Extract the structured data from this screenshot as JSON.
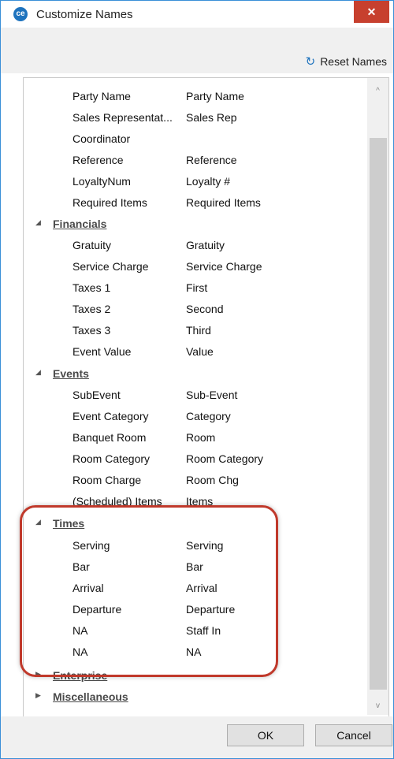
{
  "window": {
    "title": "Customize Names",
    "app_icon_label": "ce",
    "close_label": "✕"
  },
  "toolbar": {
    "reset_label": "Reset Names",
    "reset_icon": "↻"
  },
  "scrollbar": {
    "up_arrow": "^",
    "down_arrow": "v"
  },
  "rows": [
    {
      "k": "Party Name",
      "v": "Party Name"
    },
    {
      "k": "Sales Representat...",
      "v": "Sales Rep"
    },
    {
      "k": "Coordinator",
      "v": ""
    },
    {
      "k": "Reference",
      "v": "Reference"
    },
    {
      "k": "LoyaltyNum",
      "v": "Loyalty #"
    },
    {
      "k": "Required Items",
      "v": "Required Items"
    }
  ],
  "groups": {
    "financials": {
      "name": "Financials",
      "tri": "◢"
    },
    "events": {
      "name": "Events",
      "tri": "◢"
    },
    "times": {
      "name": "Times",
      "tri": "◢"
    },
    "enterprise": {
      "name": "Enterprise",
      "tri": "▶"
    },
    "miscellaneous": {
      "name": "Miscellaneous",
      "tri": "▶"
    }
  },
  "financials_rows": [
    {
      "k": "Gratuity",
      "v": "Gratuity"
    },
    {
      "k": "Service Charge",
      "v": "Service Charge"
    },
    {
      "k": "Taxes 1",
      "v": "First"
    },
    {
      "k": "Taxes 2",
      "v": "Second"
    },
    {
      "k": "Taxes 3",
      "v": "Third"
    },
    {
      "k": "Event Value",
      "v": "Value"
    }
  ],
  "events_rows": [
    {
      "k": "SubEvent",
      "v": "Sub-Event"
    },
    {
      "k": "Event Category",
      "v": "Category"
    },
    {
      "k": "Banquet Room",
      "v": "Room"
    },
    {
      "k": "Room Category",
      "v": "Room Category"
    },
    {
      "k": "Room Charge",
      "v": "Room Chg"
    },
    {
      "k": "(Scheduled) Items",
      "v": "Items"
    }
  ],
  "times_rows": [
    {
      "k": "Serving",
      "v": "Serving"
    },
    {
      "k": "Bar",
      "v": "Bar"
    },
    {
      "k": "Arrival",
      "v": "Arrival"
    },
    {
      "k": "Departure",
      "v": "Departure"
    },
    {
      "k": "NA",
      "v": "Staff In"
    },
    {
      "k": "NA",
      "v": "NA"
    }
  ],
  "footer": {
    "ok_label": "OK",
    "cancel_label": "Cancel"
  }
}
